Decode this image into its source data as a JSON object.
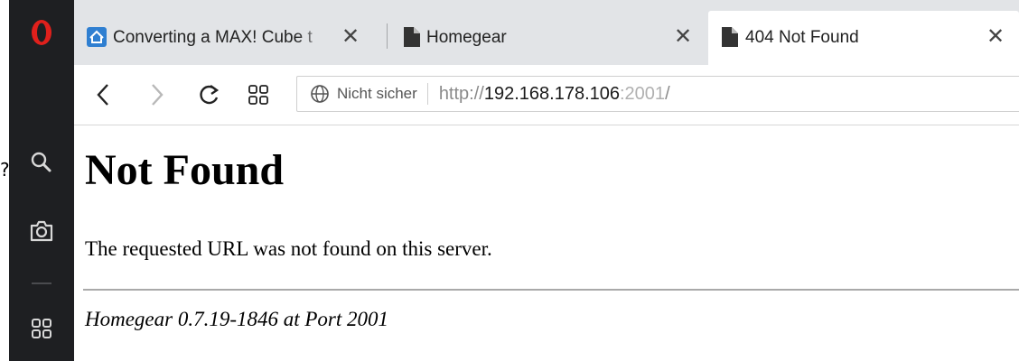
{
  "stray_text": "?",
  "sidebar": {
    "items": [
      {
        "icon": "opera-logo-icon"
      },
      {
        "icon": "search-icon"
      },
      {
        "icon": "camera-icon"
      },
      {
        "icon": "speed-dial-icon"
      }
    ]
  },
  "tabs": [
    {
      "title": "Converting a MAX! Cube t",
      "icon": "home-app-icon",
      "active": false
    },
    {
      "title": "Homegear",
      "icon": "document-icon",
      "active": false
    },
    {
      "title": "404 Not Found",
      "icon": "document-icon",
      "active": true
    }
  ],
  "tab_close_glyph": "✕",
  "address": {
    "security_label": "Nicht sicher",
    "url_scheme": "http://",
    "url_host": "192.168.178.106",
    "url_port": ":2001",
    "url_path": "/"
  },
  "page": {
    "heading": "Not Found",
    "message": "The requested URL was not found on this server.",
    "server_signature": "Homegear 0.7.19-1846 at Port 2001"
  },
  "colors": {
    "sidebar_bg": "#1e1f22",
    "opera_red": "#e0201c",
    "tabbar_bg": "#e2e4e7",
    "tab_icon_blue": "#2f7fd1",
    "url_host": "#1a1a1a",
    "url_muted": "#8a8a8a"
  }
}
